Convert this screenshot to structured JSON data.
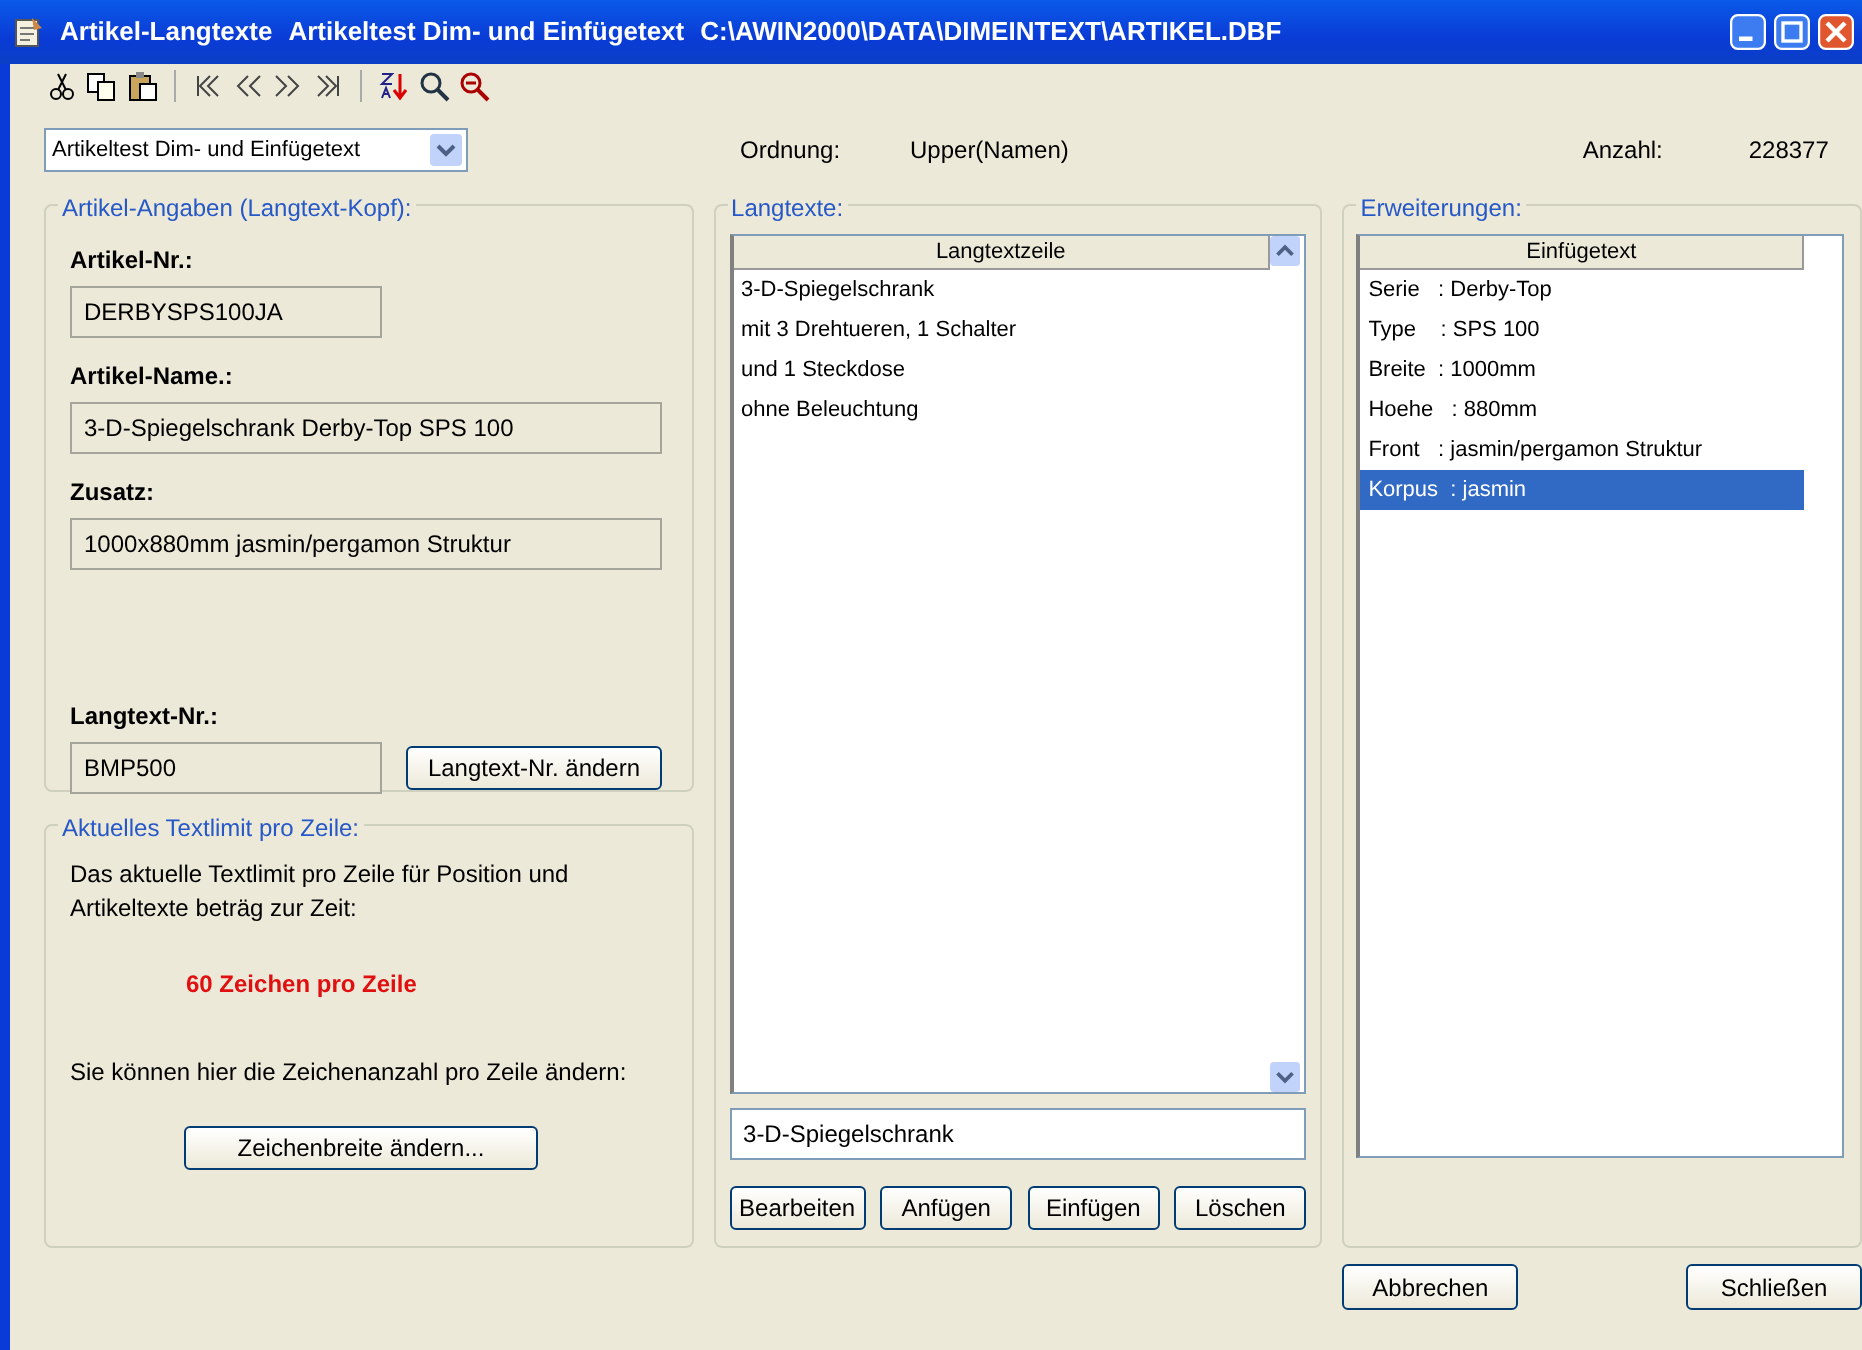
{
  "window": {
    "title_parts": [
      "Artikel-Langtexte",
      "Artikeltest Dim- und Einfügetext",
      "C:\\AWIN2000\\DATA\\DIMEINTEXT\\ARTIKEL.DBF"
    ]
  },
  "selector": {
    "value": "Artikeltest Dim- und Einfügetext"
  },
  "info": [
    {
      "label": "Ordnung:",
      "value": "Upper(Namen)"
    },
    {
      "label": "Anzahl:",
      "value": "228377"
    }
  ],
  "article_group": {
    "legend": "Artikel-Angaben (Langtext-Kopf):",
    "fields": [
      {
        "label": "Artikel-Nr.:",
        "value": "DERBYSPS100JA",
        "kind": "short"
      },
      {
        "label": "Artikel-Name.:",
        "value": "3-D-Spiegelschrank Derby-Top SPS 100",
        "kind": "long"
      },
      {
        "label": "Zusatz:",
        "value": "1000x880mm jasmin/pergamon Struktur",
        "kind": "long"
      }
    ],
    "langtext": {
      "label": "Langtext-Nr.:",
      "value": "BMP500",
      "button": "Langtext-Nr. ändern"
    }
  },
  "limit_group": {
    "legend": "Aktuelles Textlimit pro Zeile:",
    "description": "Das aktuelle Textlimit pro Zeile für Position und Artikeltexte beträg zur Zeit:",
    "limit": "60 Zeichen pro Zeile",
    "hint": "Sie können hier die Zeichenanzahl pro Zeile ändern:",
    "button": "Zeichenbreite ändern..."
  },
  "langtexte": {
    "legend": "Langtexte:",
    "column": "Langtextzeile",
    "rows": [
      "3-D-Spiegelschrank",
      "mit 3 Drehtueren, 1 Schalter",
      "und 1 Steckdose",
      "ohne Beleuchtung"
    ],
    "entry": "3-D-Spiegelschrank",
    "buttons": [
      "Bearbeiten",
      "Anfügen",
      "Einfügen",
      "Löschen"
    ]
  },
  "erweiterungen": {
    "legend": "Erweiterungen:",
    "column": "Einfügetext",
    "rows": [
      {
        "text": "Serie   : Derby-Top",
        "selected": false
      },
      {
        "text": "Type    : SPS 100",
        "selected": false
      },
      {
        "text": "Breite  : 1000mm",
        "selected": false
      },
      {
        "text": "Hoehe   : 880mm",
        "selected": false
      },
      {
        "text": "Front   : jasmin/pergamon Struktur",
        "selected": false
      },
      {
        "text": "Korpus  : jasmin",
        "selected": true
      }
    ]
  },
  "footer_buttons": [
    "Abbrechen",
    "Schließen"
  ]
}
